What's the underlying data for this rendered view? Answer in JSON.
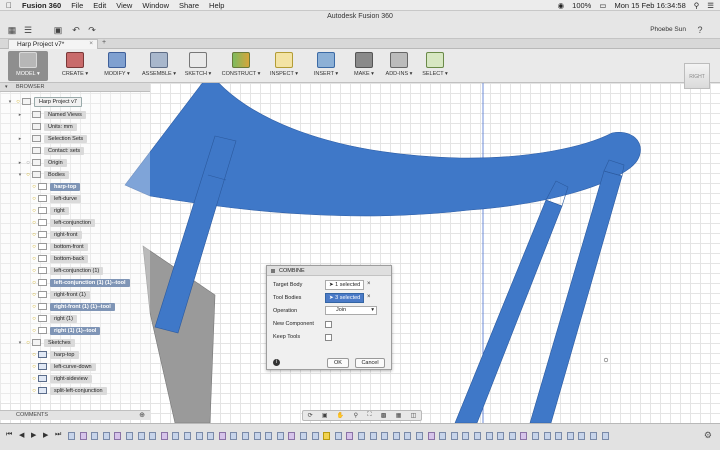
{
  "menubar": {
    "app": "Fusion 360",
    "menus": [
      "File",
      "Edit",
      "View",
      "Window",
      "Share",
      "Help"
    ],
    "battery": "100%",
    "datetime": "Mon 15 Feb  16:34:58"
  },
  "window": {
    "title": "Autodesk Fusion 360",
    "user": "Phoebe Sun"
  },
  "tab": {
    "title": "Harp Project v7*"
  },
  "toolbar": {
    "workspace": "MODEL",
    "groups": [
      "CREATE",
      "MODIFY",
      "ASSEMBLE",
      "SKETCH",
      "CONSTRUCT",
      "INSPECT",
      "INSERT",
      "MAKE",
      "ADD-INS",
      "SELECT"
    ]
  },
  "viewcube": {
    "label": "RIGHT"
  },
  "browser": {
    "header": "BROWSER",
    "root": "Harp Project v7",
    "named_views": "Named Views",
    "units": "Units: mm",
    "selection_sets": "Selection Sets",
    "contact_sets": "Contact: sets",
    "origin": "Origin",
    "bodies_folder": "Bodies",
    "bodies": [
      {
        "name": "harp-top",
        "selected": true
      },
      {
        "name": "left-durve",
        "selected": false
      },
      {
        "name": "right",
        "selected": false
      },
      {
        "name": "left-conjunction",
        "selected": false
      },
      {
        "name": "right-front",
        "selected": false
      },
      {
        "name": "bottom-front",
        "selected": false
      },
      {
        "name": "bottom-back",
        "selected": false
      },
      {
        "name": "left-conjunction (1)",
        "selected": false
      },
      {
        "name": "left-conjunction (1) (1)--tool",
        "selected": true
      },
      {
        "name": "right-front (1)",
        "selected": false
      },
      {
        "name": "right-front (1) (1)--tool",
        "selected": true
      },
      {
        "name": "right (1)",
        "selected": false
      },
      {
        "name": "right (1) (1)--tool",
        "selected": true
      }
    ],
    "sketches_folder": "Sketches",
    "sketches": [
      "harp-top",
      "left-curve-down",
      "right-sideview",
      "split-left-conjunction"
    ]
  },
  "combine": {
    "title": "COMBINE",
    "target_body_label": "Target Body",
    "target_body_value": "1 selected",
    "tool_bodies_label": "Tool Bodies",
    "tool_bodies_value": "3 selected",
    "operation_label": "Operation",
    "operation_value": "Join",
    "new_component_label": "New Component",
    "keep_tools_label": "Keep Tools",
    "ok": "OK",
    "cancel": "Cancel"
  },
  "comments": {
    "label": "COMMENTS"
  },
  "colors": {
    "body_blue": "#3f78c8",
    "body_gray": "#9a9a9a",
    "selection_blue": "#4a7ac7"
  }
}
